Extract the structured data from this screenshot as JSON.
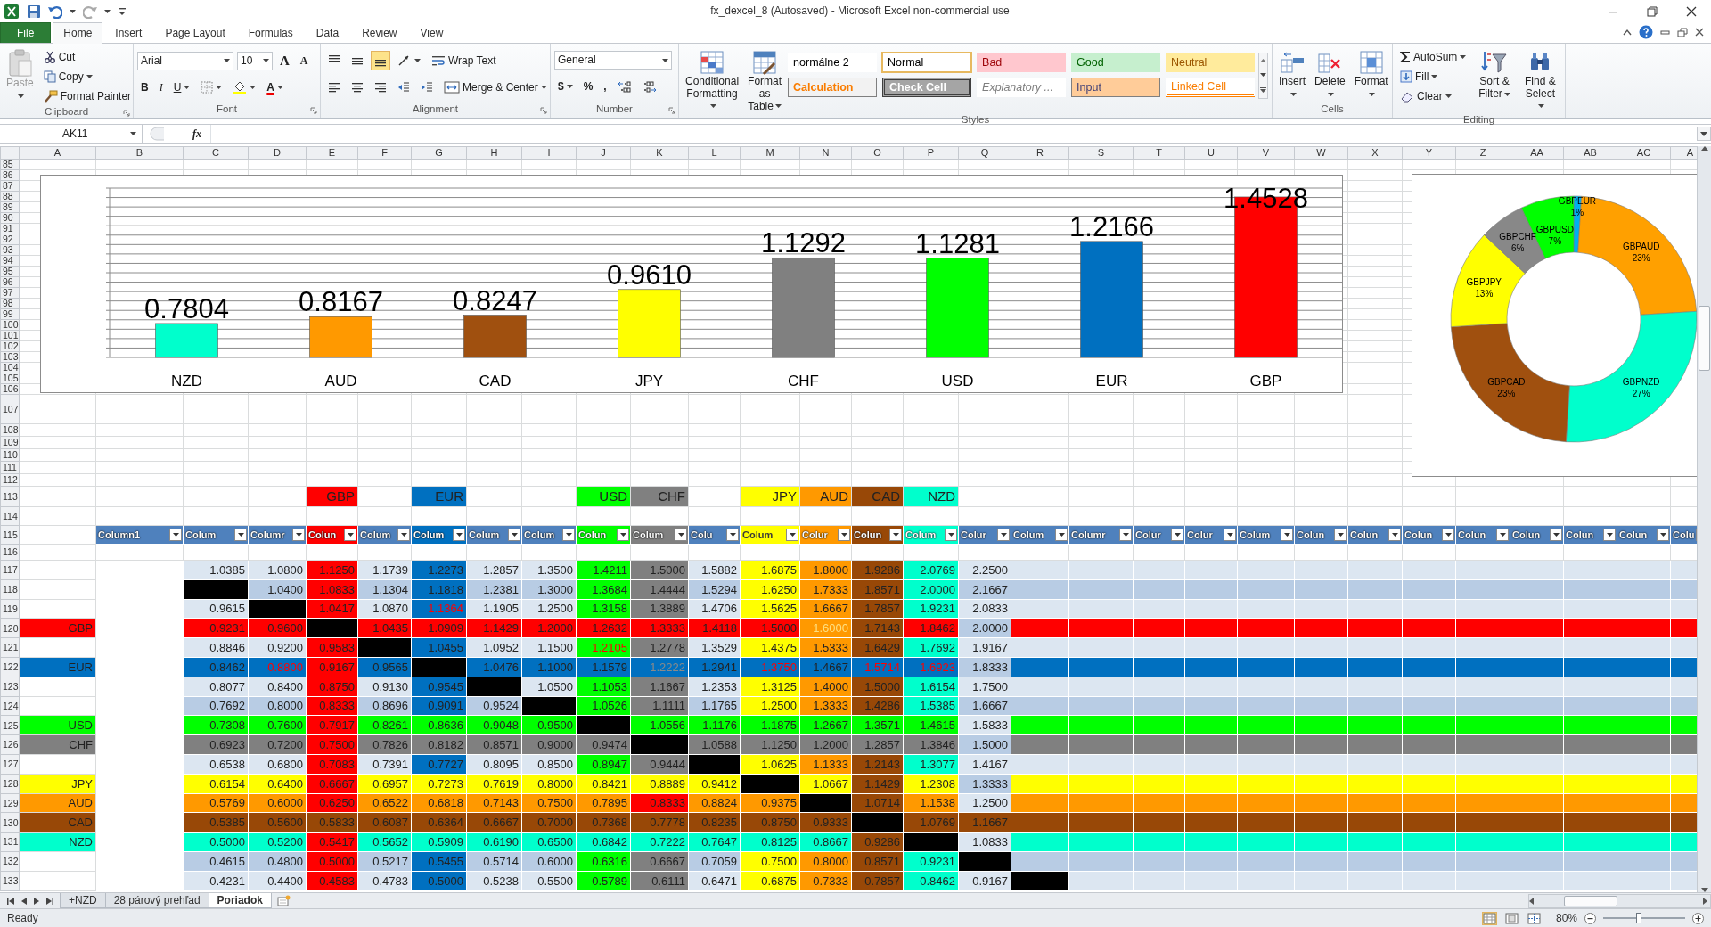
{
  "window": {
    "title": "fx_dexcel_8 (Autosaved)  -  Microsoft Excel non-commercial use"
  },
  "ribbon_tabs": [
    {
      "label": "File",
      "kind": "file",
      "selected": false
    },
    {
      "label": "Home",
      "kind": "tab",
      "selected": true
    },
    {
      "label": "Insert",
      "kind": "tab",
      "selected": false
    },
    {
      "label": "Page Layout",
      "kind": "tab",
      "selected": false
    },
    {
      "label": "Formulas",
      "kind": "tab",
      "selected": false
    },
    {
      "label": "Data",
      "kind": "tab",
      "selected": false
    },
    {
      "label": "Review",
      "kind": "tab",
      "selected": false
    },
    {
      "label": "View",
      "kind": "tab",
      "selected": false
    }
  ],
  "ribbon": {
    "clipboard": {
      "paste": "Paste",
      "cut": "Cut",
      "copy": "Copy",
      "format_painter": "Format Painter",
      "label": "Clipboard"
    },
    "font": {
      "font_name": "Arial",
      "font_size": "10",
      "grow": "A",
      "shrink": "A",
      "bold": "B",
      "italic": "I",
      "underline": "U",
      "font_color": "A",
      "label": "Font"
    },
    "alignment": {
      "wrap_text": "Wrap Text",
      "merge_center": "Merge & Center",
      "label": "Alignment"
    },
    "number": {
      "format": "General",
      "currency": "$",
      "percent": "%",
      "comma": ",",
      "label": "Number"
    },
    "styles": {
      "conditional_formatting": "Conditional Formatting",
      "format_as_table": "Format as Table",
      "label": "Styles",
      "gallery": [
        {
          "text": "normálne 2",
          "kind": "plain",
          "selected": false
        },
        {
          "text": "Normal",
          "kind": "normal",
          "selected": true
        },
        {
          "text": "Bad",
          "kind": "bad",
          "selected": false
        },
        {
          "text": "Good",
          "kind": "good",
          "selected": false
        },
        {
          "text": "Neutral",
          "kind": "neutral",
          "selected": false
        },
        {
          "text": "Calculation",
          "kind": "calculation",
          "selected": false
        },
        {
          "text": "Check Cell",
          "kind": "check",
          "selected": false
        },
        {
          "text": "Explanatory ...",
          "kind": "explanatory",
          "selected": false
        },
        {
          "text": "Input",
          "kind": "input",
          "selected": false
        },
        {
          "text": "Linked Cell",
          "kind": "linked",
          "selected": false
        }
      ]
    },
    "cells": {
      "insert": "Insert",
      "delete": "Delete",
      "format": "Format",
      "label": "Cells"
    },
    "editing": {
      "autosum": "AutoSum",
      "fill": "Fill",
      "clear": "Clear",
      "sort_filter": "Sort & Filter",
      "find_select": "Find & Select",
      "label": "Editing"
    }
  },
  "formula_bar": {
    "name_box": "AK11",
    "fx": "fx"
  },
  "sheet": {
    "columns": [
      "A",
      "B",
      "C",
      "D",
      "E",
      "F",
      "G",
      "H",
      "I",
      "J",
      "K",
      "L",
      "M",
      "N",
      "O",
      "P",
      "Q",
      "R",
      "S",
      "T",
      "U",
      "V",
      "W",
      "X",
      "Y",
      "Z",
      "AA",
      "AB",
      "AC",
      "A"
    ],
    "upper_rows": [
      "85",
      "86",
      "87",
      "88",
      "89",
      "90",
      "91",
      "92",
      "93",
      "94",
      "95",
      "96",
      "97",
      "98",
      "99",
      "100",
      "101",
      "102",
      "103",
      "104",
      "105",
      "106",
      "107"
    ],
    "spacer_rows": [
      "108",
      "109",
      "110",
      "111",
      "112"
    ],
    "currency_row": {
      "number": "113",
      "cells": [
        {},
        {},
        {},
        {},
        {
          "text": "GBP",
          "color": "#ff0000"
        },
        {},
        {
          "text": "EUR",
          "color": "#0070c0"
        },
        {},
        {},
        {
          "text": "USD",
          "color": "#00ff00"
        },
        {
          "text": "CHF",
          "color": "#808080"
        },
        {},
        {
          "text": "JPY",
          "color": "#ffff00"
        },
        {
          "text": "AUD",
          "color": "#ff9900"
        },
        {
          "text": "CAD",
          "color": "#984807"
        },
        {
          "text": "NZD",
          "color": "#00ffcc"
        }
      ]
    },
    "rows_before_header": [
      "114"
    ],
    "header_row": {
      "number": "115",
      "cells": [
        {},
        {
          "text": "Column1"
        },
        {
          "text": "Colum"
        },
        {
          "text": "Columr"
        },
        {
          "text": "Colun",
          "color": "#ff0000"
        },
        {
          "text": "Colum"
        },
        {
          "text": "Colum",
          "color": "#0070c0"
        },
        {
          "text": "Colum"
        },
        {
          "text": "Colum"
        },
        {
          "text": "Colun",
          "color": "#00ff00"
        },
        {
          "text": "Colum",
          "color": "#808080"
        },
        {
          "text": "Colu"
        },
        {
          "text": "Colum",
          "color": "#ffff00"
        },
        {
          "text": "Colur",
          "color": "#ff9900"
        },
        {
          "text": "Colun",
          "color": "#984807"
        },
        {
          "text": "Colum",
          "color": "#00ffcc"
        },
        {
          "text": "Colur"
        },
        {
          "text": "Colum"
        },
        {
          "text": "Columr"
        },
        {
          "text": "Colur"
        },
        {
          "text": "Colur"
        },
        {
          "text": "Colum"
        },
        {
          "text": "Colun"
        },
        {
          "text": "Colun"
        },
        {
          "text": "Colun"
        },
        {
          "text": "Colun"
        },
        {
          "text": "Colun"
        },
        {
          "text": "Colun"
        },
        {
          "text": "Colun"
        },
        {
          "text": "Colu"
        }
      ]
    },
    "rows_after_header": [
      "116"
    ],
    "data_rows": [
      {
        "number": "117",
        "cells": [
          {
            "text": "1.0385"
          },
          {
            "text": "1.0800"
          },
          {
            "text": "1.1250",
            "color": "#ff0000"
          },
          {
            "text": "1.1739"
          },
          {
            "text": "1.2273",
            "color": "#0070c0"
          },
          {
            "text": "1.2857"
          },
          {
            "text": "1.3500"
          },
          {
            "text": "1.4211",
            "color": "#00ff00"
          },
          {
            "text": "1.5000",
            "color": "#808080"
          },
          {
            "text": "1.5882"
          },
          {
            "text": "1.6875",
            "color": "#ffff00"
          },
          {
            "text": "1.8000",
            "color": "#ff9900"
          },
          {
            "text": "1.9286",
            "color": "#984807"
          },
          {
            "text": "2.0769",
            "color": "#00ffcc"
          },
          {
            "text": "2.2500"
          }
        ]
      },
      {
        "number": "118",
        "cells": [
          {
            "color": "#000000"
          },
          {
            "text": "1.0400"
          },
          {
            "text": "1.0833",
            "color": "#ff0000"
          },
          {
            "text": "1.1304"
          },
          {
            "text": "1.1818",
            "color": "#0070c0"
          },
          {
            "text": "1.2381"
          },
          {
            "text": "1.3000"
          },
          {
            "text": "1.3684",
            "color": "#00ff00"
          },
          {
            "text": "1.4444",
            "color": "#808080"
          },
          {
            "text": "1.5294"
          },
          {
            "text": "1.6250",
            "color": "#ffff00"
          },
          {
            "text": "1.7333",
            "color": "#ff9900"
          },
          {
            "text": "1.8571",
            "color": "#984807"
          },
          {
            "text": "2.0000",
            "color": "#00ffcc"
          },
          {
            "text": "2.1667"
          }
        ]
      },
      {
        "number": "119",
        "cells": [
          {
            "text": "0.9615"
          },
          {
            "color": "#000000"
          },
          {
            "text": "1.0417",
            "color": "#ff0000"
          },
          {
            "text": "1.0870"
          },
          {
            "text": "1.1364",
            "color": "#0070c0",
            "font": {
              "color": "#ff0000"
            }
          },
          {
            "text": "1.1905"
          },
          {
            "text": "1.2500"
          },
          {
            "text": "1.3158",
            "color": "#00ff00"
          },
          {
            "text": "1.3889",
            "color": "#808080"
          },
          {
            "text": "1.4706"
          },
          {
            "text": "1.5625",
            "color": "#ffff00"
          },
          {
            "text": "1.6667",
            "color": "#ff9900"
          },
          {
            "text": "1.7857",
            "color": "#984807"
          },
          {
            "text": "1.9231",
            "color": "#00ffcc"
          },
          {
            "text": "2.0833"
          }
        ]
      },
      {
        "number": "120",
        "label": {
          "text": "GBP",
          "color": "#ff0000"
        },
        "band": {
          "color": "#ff0000"
        },
        "cells": [
          {
            "text": "0.9231",
            "color": "#ff0000"
          },
          {
            "text": "0.9600",
            "color": "#ff0000"
          },
          {
            "color": "#000000"
          },
          {
            "text": "1.0435",
            "color": "#ff0000"
          },
          {
            "text": "1.0909",
            "color": "#ff0000"
          },
          {
            "text": "1.1429",
            "color": "#ff0000"
          },
          {
            "text": "1.2000",
            "color": "#ff0000"
          },
          {
            "text": "1.2632",
            "color": "#ff0000"
          },
          {
            "text": "1.3333",
            "color": "#ff0000"
          },
          {
            "text": "1.4118",
            "color": "#ff0000"
          },
          {
            "text": "1.5000",
            "color": "#ff0000"
          },
          {
            "text": "1.6000",
            "color": "#ff9900",
            "font": {
              "color": "#ffe080"
            }
          },
          {
            "text": "1.7143",
            "color": "#984807"
          },
          {
            "text": "1.8462",
            "color": "#ff0000"
          },
          {
            "text": "2.0000"
          }
        ]
      },
      {
        "number": "121",
        "cells": [
          {
            "text": "0.8846"
          },
          {
            "text": "0.9200"
          },
          {
            "text": "0.9583",
            "color": "#ff0000"
          },
          {
            "color": "#000000"
          },
          {
            "text": "1.0455",
            "color": "#0070c0"
          },
          {
            "text": "1.0952"
          },
          {
            "text": "1.1500"
          },
          {
            "text": "1.2105",
            "color": "#00ff00",
            "font": {
              "color": "#ff0000"
            }
          },
          {
            "text": "1.2778",
            "color": "#808080"
          },
          {
            "text": "1.3529"
          },
          {
            "text": "1.4375",
            "color": "#ffff00"
          },
          {
            "text": "1.5333",
            "color": "#ff9900"
          },
          {
            "text": "1.6429",
            "color": "#984807"
          },
          {
            "text": "1.7692",
            "color": "#00ffcc"
          },
          {
            "text": "1.9167"
          }
        ]
      },
      {
        "number": "122",
        "label": {
          "text": "EUR",
          "color": "#0070c0"
        },
        "band": {
          "color": "#0070c0"
        },
        "cells": [
          {
            "text": "0.8462",
            "color": "#0070c0"
          },
          {
            "text": "0.8800",
            "color": "#0070c0",
            "font": {
              "color": "#ff0000"
            }
          },
          {
            "text": "0.9167",
            "color": "#ff0000"
          },
          {
            "text": "0.9565",
            "color": "#0070c0"
          },
          {
            "color": "#000000"
          },
          {
            "text": "1.0476",
            "color": "#0070c0"
          },
          {
            "text": "1.1000",
            "color": "#0070c0"
          },
          {
            "text": "1.1579",
            "color": "#0070c0"
          },
          {
            "text": "1.2222",
            "color": "#0070c0",
            "font": {
              "color": "#8a8a8a"
            }
          },
          {
            "text": "1.2941",
            "color": "#0070c0"
          },
          {
            "text": "1.3750",
            "color": "#0070c0",
            "font": {
              "color": "#ff0000"
            }
          },
          {
            "text": "1.4667",
            "color": "#0070c0"
          },
          {
            "text": "1.5714",
            "color": "#0070c0",
            "font": {
              "color": "#ff0000"
            }
          },
          {
            "text": "1.6923",
            "color": "#0070c0",
            "font": {
              "color": "#ff0000"
            }
          },
          {
            "text": "1.8333"
          }
        ]
      },
      {
        "number": "123",
        "cells": [
          {
            "text": "0.8077"
          },
          {
            "text": "0.8400"
          },
          {
            "text": "0.8750",
            "color": "#ff0000"
          },
          {
            "text": "0.9130"
          },
          {
            "text": "0.9545",
            "color": "#0070c0"
          },
          {
            "color": "#000000"
          },
          {
            "text": "1.0500"
          },
          {
            "text": "1.1053",
            "color": "#00ff00"
          },
          {
            "text": "1.1667",
            "color": "#808080"
          },
          {
            "text": "1.2353"
          },
          {
            "text": "1.3125",
            "color": "#ffff00"
          },
          {
            "text": "1.4000",
            "color": "#ff9900"
          },
          {
            "text": "1.5000",
            "color": "#984807"
          },
          {
            "text": "1.6154",
            "color": "#00ffcc"
          },
          {
            "text": "1.7500"
          }
        ]
      },
      {
        "number": "124",
        "cells": [
          {
            "text": "0.7692"
          },
          {
            "text": "0.8000"
          },
          {
            "text": "0.8333",
            "color": "#ff0000"
          },
          {
            "text": "0.8696"
          },
          {
            "text": "0.9091",
            "color": "#0070c0"
          },
          {
            "text": "0.9524"
          },
          {
            "color": "#000000"
          },
          {
            "text": "1.0526",
            "color": "#00ff00"
          },
          {
            "text": "1.1111",
            "color": "#808080"
          },
          {
            "text": "1.1765"
          },
          {
            "text": "1.2500",
            "color": "#ffff00"
          },
          {
            "text": "1.3333",
            "color": "#ff9900"
          },
          {
            "text": "1.4286",
            "color": "#984807"
          },
          {
            "text": "1.5385",
            "color": "#00ffcc"
          },
          {
            "text": "1.6667"
          }
        ]
      },
      {
        "number": "125",
        "label": {
          "text": "USD",
          "color": "#00ff00"
        },
        "band": {
          "color": "#00ff00"
        },
        "cells": [
          {
            "text": "0.7308",
            "color": "#00ff00"
          },
          {
            "text": "0.7600",
            "color": "#00ff00"
          },
          {
            "text": "0.7917",
            "color": "#ff0000"
          },
          {
            "text": "0.8261",
            "color": "#00ff00"
          },
          {
            "text": "0.8636",
            "color": "#00ff00"
          },
          {
            "text": "0.9048",
            "color": "#00ff00"
          },
          {
            "text": "0.9500",
            "color": "#00ff00"
          },
          {
            "color": "#000000"
          },
          {
            "text": "1.0556",
            "color": "#00ff00"
          },
          {
            "text": "1.1176",
            "color": "#00ff00"
          },
          {
            "text": "1.1875",
            "color": "#00ff00"
          },
          {
            "text": "1.2667",
            "color": "#00ff00"
          },
          {
            "text": "1.3571",
            "color": "#00ff00"
          },
          {
            "text": "1.4615",
            "color": "#00ff00"
          },
          {
            "text": "1.5833"
          }
        ]
      },
      {
        "number": "126",
        "label": {
          "text": "CHF",
          "color": "#808080"
        },
        "band": {
          "color": "#808080"
        },
        "cells": [
          {
            "text": "0.6923",
            "color": "#808080"
          },
          {
            "text": "0.7200",
            "color": "#808080"
          },
          {
            "text": "0.7500",
            "color": "#ff0000"
          },
          {
            "text": "0.7826",
            "color": "#808080"
          },
          {
            "text": "0.8182",
            "color": "#808080"
          },
          {
            "text": "0.8571",
            "color": "#808080"
          },
          {
            "text": "0.9000",
            "color": "#808080"
          },
          {
            "text": "0.9474",
            "color": "#808080"
          },
          {
            "color": "#000000"
          },
          {
            "text": "1.0588",
            "color": "#808080"
          },
          {
            "text": "1.1250",
            "color": "#808080"
          },
          {
            "text": "1.2000",
            "color": "#808080"
          },
          {
            "text": "1.2857",
            "color": "#808080"
          },
          {
            "text": "1.3846",
            "color": "#808080"
          },
          {
            "text": "1.5000"
          }
        ]
      },
      {
        "number": "127",
        "cells": [
          {
            "text": "0.6538"
          },
          {
            "text": "0.6800"
          },
          {
            "text": "0.7083",
            "color": "#ff0000"
          },
          {
            "text": "0.7391"
          },
          {
            "text": "0.7727",
            "color": "#0070c0"
          },
          {
            "text": "0.8095"
          },
          {
            "text": "0.8500"
          },
          {
            "text": "0.8947",
            "color": "#00ff00"
          },
          {
            "text": "0.9444",
            "color": "#808080"
          },
          {
            "color": "#000000"
          },
          {
            "text": "1.0625",
            "color": "#ffff00"
          },
          {
            "text": "1.1333",
            "color": "#ff9900"
          },
          {
            "text": "1.2143",
            "color": "#984807"
          },
          {
            "text": "1.3077",
            "color": "#00ffcc"
          },
          {
            "text": "1.4167"
          }
        ]
      },
      {
        "number": "128",
        "label": {
          "text": "JPY",
          "color": "#ffff00"
        },
        "band": {
          "color": "#ffff00"
        },
        "cells": [
          {
            "text": "0.6154",
            "color": "#ffff00"
          },
          {
            "text": "0.6400",
            "color": "#ffff00"
          },
          {
            "text": "0.6667",
            "color": "#ff0000"
          },
          {
            "text": "0.6957",
            "color": "#ffff00"
          },
          {
            "text": "0.7273",
            "color": "#ffff00"
          },
          {
            "text": "0.7619",
            "color": "#ffff00"
          },
          {
            "text": "0.8000",
            "color": "#ffff00"
          },
          {
            "text": "0.8421",
            "color": "#ffff00"
          },
          {
            "text": "0.8889",
            "color": "#ffff00"
          },
          {
            "text": "0.9412",
            "color": "#ffff00"
          },
          {
            "color": "#000000"
          },
          {
            "text": "1.0667",
            "color": "#ffff00"
          },
          {
            "text": "1.1429",
            "color": "#984807"
          },
          {
            "text": "1.2308",
            "color": "#ffff00"
          },
          {
            "text": "1.3333"
          }
        ]
      },
      {
        "number": "129",
        "label": {
          "text": "AUD",
          "color": "#ff9900"
        },
        "band": {
          "color": "#ff9900"
        },
        "cells": [
          {
            "text": "0.5769",
            "color": "#ff9900"
          },
          {
            "text": "0.6000",
            "color": "#ff9900"
          },
          {
            "text": "0.6250",
            "color": "#ff0000"
          },
          {
            "text": "0.6522",
            "color": "#ff9900"
          },
          {
            "text": "0.6818",
            "color": "#ff9900"
          },
          {
            "text": "0.7143",
            "color": "#ff9900"
          },
          {
            "text": "0.7500",
            "color": "#ff9900"
          },
          {
            "text": "0.7895",
            "color": "#ff9900"
          },
          {
            "text": "0.8333",
            "color": "#ff0000"
          },
          {
            "text": "0.8824",
            "color": "#ff9900"
          },
          {
            "text": "0.9375",
            "color": "#ff9900"
          },
          {
            "color": "#000000"
          },
          {
            "text": "1.0714",
            "color": "#984807"
          },
          {
            "text": "1.1538",
            "color": "#ff9900"
          },
          {
            "text": "1.2500"
          }
        ]
      },
      {
        "number": "130",
        "label": {
          "text": "CAD",
          "color": "#984807"
        },
        "band": {
          "color": "#984807"
        },
        "cells": [
          {
            "text": "0.5385",
            "color": "#984807"
          },
          {
            "text": "0.5600",
            "color": "#984807"
          },
          {
            "text": "0.5833",
            "color": "#984807"
          },
          {
            "text": "0.6087",
            "color": "#984807"
          },
          {
            "text": "0.6364",
            "color": "#984807"
          },
          {
            "text": "0.6667",
            "color": "#984807"
          },
          {
            "text": "0.7000",
            "color": "#984807"
          },
          {
            "text": "0.7368",
            "color": "#984807"
          },
          {
            "text": "0.7778",
            "color": "#984807"
          },
          {
            "text": "0.8235",
            "color": "#984807"
          },
          {
            "text": "0.8750",
            "color": "#984807"
          },
          {
            "text": "0.9333",
            "color": "#984807"
          },
          {
            "color": "#000000"
          },
          {
            "text": "1.0769",
            "color": "#984807"
          },
          {
            "text": "1.1667",
            "color": "#984807"
          }
        ]
      },
      {
        "number": "131",
        "label": {
          "text": "NZD",
          "color": "#00ffcc"
        },
        "band": {
          "color": "#00ffcc"
        },
        "cells": [
          {
            "text": "0.5000",
            "color": "#00ffcc"
          },
          {
            "text": "0.5200",
            "color": "#00ffcc"
          },
          {
            "text": "0.5417",
            "color": "#ff0000"
          },
          {
            "text": "0.5652",
            "color": "#00ffcc"
          },
          {
            "text": "0.5909",
            "color": "#00ffcc"
          },
          {
            "text": "0.6190",
            "color": "#00ffcc"
          },
          {
            "text": "0.6500",
            "color": "#00ffcc"
          },
          {
            "text": "0.6842",
            "color": "#00ffcc"
          },
          {
            "text": "0.7222",
            "color": "#00ffcc"
          },
          {
            "text": "0.7647",
            "color": "#00ffcc"
          },
          {
            "text": "0.8125",
            "color": "#00ffcc"
          },
          {
            "text": "0.8667",
            "color": "#00ffcc"
          },
          {
            "text": "0.9286",
            "color": "#984807"
          },
          {
            "color": "#000000"
          },
          {
            "text": "1.0833"
          }
        ]
      },
      {
        "number": "132",
        "cells": [
          {
            "text": "0.4615"
          },
          {
            "text": "0.4800"
          },
          {
            "text": "0.5000",
            "color": "#ff0000"
          },
          {
            "text": "0.5217"
          },
          {
            "text": "0.5455",
            "color": "#0070c0"
          },
          {
            "text": "0.5714"
          },
          {
            "text": "0.6000"
          },
          {
            "text": "0.6316",
            "color": "#00ff00"
          },
          {
            "text": "0.6667",
            "color": "#808080"
          },
          {
            "text": "0.7059"
          },
          {
            "text": "0.7500",
            "color": "#ffff00"
          },
          {
            "text": "0.8000",
            "color": "#ff9900"
          },
          {
            "text": "0.8571",
            "color": "#984807"
          },
          {
            "text": "0.9231",
            "color": "#00ffcc"
          },
          {
            "color": "#000000"
          }
        ]
      },
      {
        "number": "133",
        "cells": [
          {
            "text": "0.4231"
          },
          {
            "text": "0.4400"
          },
          {
            "text": "0.4583",
            "color": "#ff0000"
          },
          {
            "text": "0.4783"
          },
          {
            "text": "0.5000",
            "color": "#0070c0"
          },
          {
            "text": "0.5238"
          },
          {
            "text": "0.5500"
          },
          {
            "text": "0.5789",
            "color": "#00ff00"
          },
          {
            "text": "0.6111",
            "color": "#808080"
          },
          {
            "text": "0.6471"
          },
          {
            "text": "0.6875",
            "color": "#ffff00"
          },
          {
            "text": "0.7333",
            "color": "#ff9900"
          },
          {
            "text": "0.7857",
            "color": "#984807"
          },
          {
            "text": "0.8462",
            "color": "#00ffcc"
          },
          {
            "text": "0.9167"
          },
          {
            "color": "#000000"
          }
        ]
      }
    ]
  },
  "bar_chart": {
    "chart_data": {
      "type": "bar",
      "categories": [
        "NZD",
        "AUD",
        "CAD",
        "JPY",
        "CHF",
        "USD",
        "EUR",
        "GBP"
      ],
      "values": [
        0.7804,
        0.8167,
        0.8247,
        0.961,
        1.1292,
        1.1281,
        1.2166,
        1.4528
      ],
      "value_labels": [
        "0.7804",
        "0.8167",
        "0.8247",
        "0.9610",
        "1.1292",
        "1.1281",
        "1.2166",
        "1.4528"
      ],
      "ylim": [
        0.6,
        1.5
      ]
    },
    "bars": [
      {
        "color": "#00ffcc"
      },
      {
        "color": "#ff9900"
      },
      {
        "color": "#a0500f"
      },
      {
        "color": "#ffff00"
      },
      {
        "color": "#808080"
      },
      {
        "color": "#00ff00"
      },
      {
        "color": "#0070c0"
      },
      {
        "color": "#ff0000"
      }
    ]
  },
  "donut_chart": {
    "chart_data": {
      "type": "donut",
      "categories": [
        "GBPEUR",
        "GBPAUD",
        "GBPNZD",
        "GBPCAD",
        "GBPJPY",
        "GBPCHF",
        "GBPUSD"
      ],
      "values": [
        1,
        23,
        27,
        23,
        13,
        6,
        7
      ],
      "value_labels": [
        "1%",
        "23%",
        "27%",
        "23%",
        "13%",
        "6%",
        "7%"
      ]
    },
    "slices": [
      {
        "color": "#00b0f0"
      },
      {
        "color": "#ffa000"
      },
      {
        "color": "#00ffcc"
      },
      {
        "color": "#a0500f"
      },
      {
        "color": "#ffff00"
      },
      {
        "color": "#888888"
      },
      {
        "color": "#00ff00"
      }
    ]
  },
  "sheet_tabs": [
    {
      "label": "+NZD",
      "selected": false
    },
    {
      "label": "28 párový prehľad",
      "selected": false
    },
    {
      "label": "Poriadok",
      "selected": true
    }
  ],
  "status_bar": {
    "text": "Ready",
    "views": [
      {
        "kind": "normal",
        "selected": true
      },
      {
        "kind": "page_layout",
        "selected": false
      },
      {
        "kind": "page_break",
        "selected": false
      }
    ],
    "zoom": {
      "text": "80%",
      "level": 0.43
    }
  }
}
